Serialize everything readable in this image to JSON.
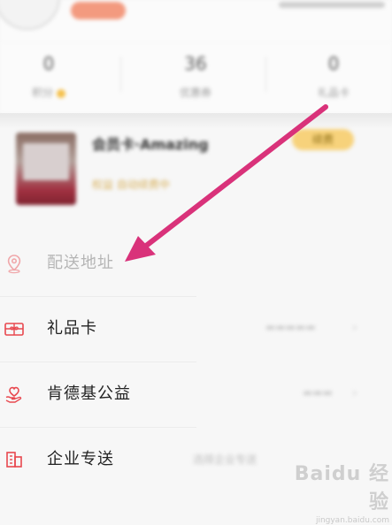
{
  "stats": [
    {
      "value": "0",
      "label": "积分"
    },
    {
      "value": "36",
      "label": "优惠券"
    },
    {
      "value": "0",
      "label": "礼品卡"
    }
  ],
  "member_card": {
    "title": "会员卡·Amazing",
    "subtitle": "权益 自动续费中",
    "button": "续费"
  },
  "menu": {
    "items": [
      {
        "label": "配送地址",
        "icon": "location-pin-icon",
        "hint": "",
        "faded": true
      },
      {
        "label": "礼品卡",
        "icon": "gift-card-icon",
        "hint": "",
        "faded": false
      },
      {
        "label": "肯德基公益",
        "icon": "charity-heart-hand-icon",
        "hint": "",
        "faded": false
      },
      {
        "label": "企业专送",
        "icon": "enterprise-building-icon",
        "hint": "选择企业专送",
        "faded": false
      }
    ]
  },
  "annotation_arrow": {
    "color": "#d9327a"
  },
  "watermark": {
    "main": "Baidu 经验",
    "url": "jingyan.baidu.com"
  },
  "colors": {
    "accent": "#e8484f",
    "arrow": "#d9327a",
    "gold": "#f7d27b"
  }
}
